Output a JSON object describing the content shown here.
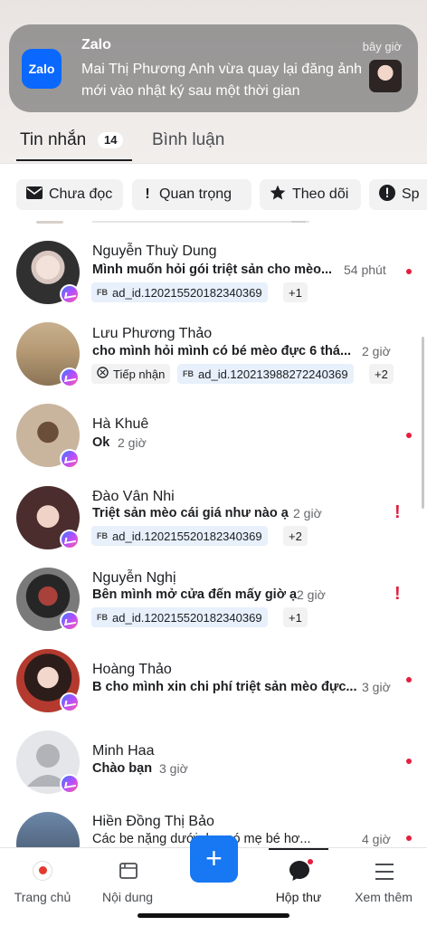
{
  "notification": {
    "app_name": "Zalo",
    "app_icon_text": "Zalo",
    "time": "bây giờ",
    "body": "Mai Thị Phương Anh vừa quay lại đăng ảnh mới vào nhật ký sau một thời gian"
  },
  "tabs": {
    "messages_label": "Tin nhắn",
    "messages_count": "14",
    "comments_label": "Bình luận"
  },
  "filters": [
    {
      "label": "Chưa đọc",
      "icon": "envelope-icon"
    },
    {
      "label": "Quan trọng",
      "icon": "exclamation-icon"
    },
    {
      "label": "Theo dõi",
      "icon": "star-icon"
    },
    {
      "label": "Sp",
      "icon": "alert-circle-icon"
    }
  ],
  "conversations": [
    {
      "name": "Nguyễn Thuỳ Dung",
      "preview": "Mình muốn hỏi gói triệt sản cho mèo...",
      "time": "54 phút",
      "tags": [
        "ad_id.120215520182340369"
      ],
      "more": "+1",
      "marker": "dot"
    },
    {
      "name": "Lưu Phương Thảo",
      "preview": "cho mình hỏi mình có bé mèo đực 6 thá...",
      "time": "2 giờ",
      "status_tag": "Tiếp nhận",
      "tags": [
        "ad_id.120213988272240369"
      ],
      "more": "+2",
      "marker": "none"
    },
    {
      "name": "Hà Khuê",
      "preview": "Ok",
      "time": "2 giờ",
      "marker": "dot"
    },
    {
      "name": "Đào Vân Nhi",
      "preview": "Triệt sản mèo cái giá như nào ạ",
      "time": "2 giờ",
      "tags": [
        "ad_id.120215520182340369"
      ],
      "more": "+2",
      "marker": "exclamation"
    },
    {
      "name": "Nguyễn Nghị",
      "preview": "Bên mình mở cửa đến mấy giờ ạ",
      "time": "2 giờ",
      "tags": [
        "ad_id.120215520182340369"
      ],
      "more": "+1",
      "marker": "exclamation"
    },
    {
      "name": "Hoàng Thảo",
      "preview": "B cho mình xin chi phí triệt sản mèo đực...",
      "time": "3 giờ",
      "marker": "dot"
    },
    {
      "name": "Minh Haa",
      "preview": "Chào bạn",
      "time": "3 giờ",
      "marker": "dot"
    },
    {
      "name": "Hiền Đồng Thị Bảo",
      "preview": "Các be nặng dưới duy có mẹ bé hơ...",
      "time": "4 giờ",
      "marker": "dot"
    }
  ],
  "fb_tag_prefix": "FB",
  "exclamation_glyph": "!",
  "bottom_nav": {
    "home": "Trang chủ",
    "content": "Nội dung",
    "create": "+",
    "inbox": "Hộp thư",
    "more": "Xem thêm"
  },
  "colors": {
    "accent": "#1877f2",
    "unread_dot": "#e41e3f",
    "tag_bg": "#e7f0fb"
  }
}
